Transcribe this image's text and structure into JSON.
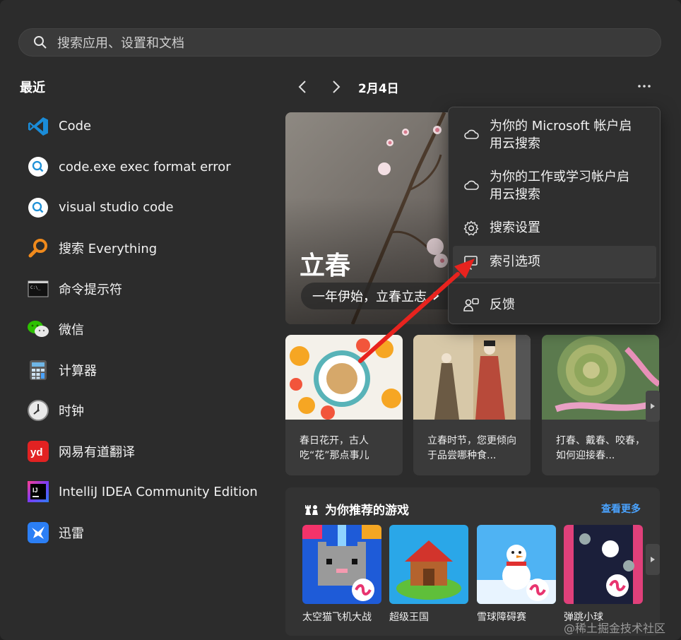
{
  "search": {
    "placeholder": "搜索应用、设置和文档"
  },
  "recent": {
    "title": "最近",
    "items": [
      {
        "label": "Code",
        "icon": "vscode-icon"
      },
      {
        "label": "code.exe exec format error",
        "icon": "web-search-icon"
      },
      {
        "label": "visual studio code",
        "icon": "web-search-icon"
      },
      {
        "label": "搜索 Everything",
        "icon": "everything-icon"
      },
      {
        "label": "命令提示符",
        "icon": "cmd-icon"
      },
      {
        "label": "微信",
        "icon": "wechat-icon"
      },
      {
        "label": "计算器",
        "icon": "calculator-icon"
      },
      {
        "label": "时钟",
        "icon": "clock-icon"
      },
      {
        "label": "网易有道翻译",
        "icon": "youdao-icon"
      },
      {
        "label": "IntelliJ IDEA Community Edition",
        "icon": "intellij-icon"
      },
      {
        "label": "迅雷",
        "icon": "xunlei-icon"
      }
    ]
  },
  "nav": {
    "date": "2月4日"
  },
  "hero": {
    "title": "立春",
    "subtitle": "一年伊始，立春立志"
  },
  "cards": [
    {
      "text": "春日花开，古人吃“花”那点事儿"
    },
    {
      "text": "立春时节，您更倾向于品尝哪种食..."
    },
    {
      "text": "打春、戴春、咬春，如何迎接春..."
    }
  ],
  "games": {
    "title": "为你推荐的游戏",
    "see_more": "查看更多",
    "items": [
      {
        "name": "太空猫飞机大战"
      },
      {
        "name": "超级王国"
      },
      {
        "name": "雪球障碍赛"
      },
      {
        "name": "弹跳小球"
      }
    ]
  },
  "menu": {
    "items": [
      {
        "label": "为你的 Microsoft 帐户启用云搜索",
        "icon": "cloud-icon"
      },
      {
        "label": "为你的工作或学习帐户启用云搜索",
        "icon": "cloud-icon"
      },
      {
        "label": "搜索设置",
        "icon": "gear-icon"
      },
      {
        "label": "索引选项",
        "icon": "indexing-icon"
      },
      {
        "label": "反馈",
        "icon": "feedback-icon"
      }
    ]
  },
  "watermark": "@稀土掘金技术社区",
  "colors": {
    "accent": "#4aa3ff",
    "arrow": "#e8231e"
  }
}
